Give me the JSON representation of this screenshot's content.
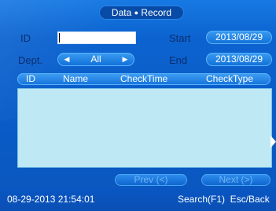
{
  "title": {
    "left": "Data",
    "separator": "●",
    "right": "Record"
  },
  "form": {
    "id_label": "ID",
    "id_value": "",
    "dept_label": "Dept.",
    "dept_value": "All",
    "start_label": "Start",
    "start_value": "2013/08/29",
    "end_label": "End",
    "end_value": "2013/08/29"
  },
  "table": {
    "columns": [
      "ID",
      "Name",
      "CheckTime",
      "CheckType"
    ],
    "rows": []
  },
  "pagination": {
    "prev_label": "Prev (<)",
    "next_label": "Next (>)"
  },
  "status": {
    "datetime": "08-29-2013 21:54:01",
    "hints": "Search(F1)  Esc/Back"
  },
  "colors": {
    "background": "#0c63cf",
    "label_text": "#0a2f6f",
    "table_background": "#bfe8f5",
    "disabled_button_text": "#6fb5f4"
  }
}
